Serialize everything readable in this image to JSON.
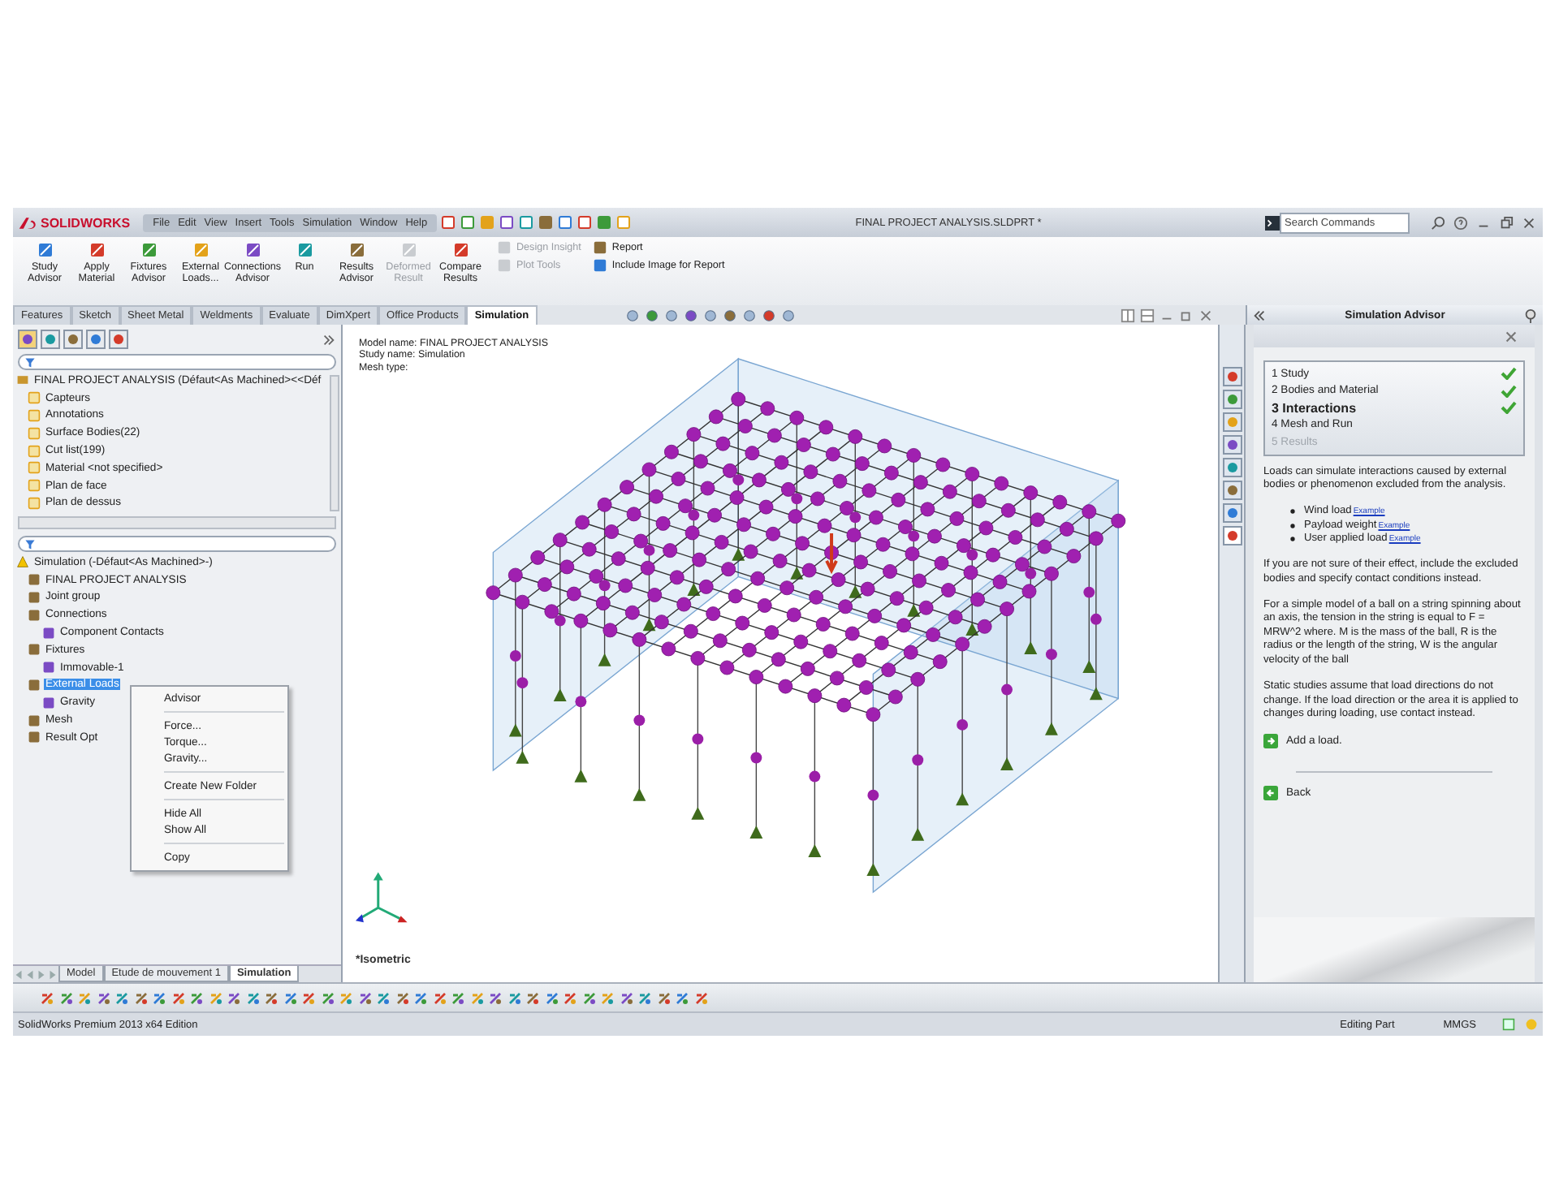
{
  "app": {
    "logo": "SOLIDWORKS",
    "menus": [
      "File",
      "Edit",
      "View",
      "Insert",
      "Tools",
      "Simulation",
      "Window",
      "Help"
    ],
    "document_title": "FINAL PROJECT ANALYSIS.SLDPRT *",
    "search": {
      "placeholder": "Search Commands"
    }
  },
  "command_manager": [
    {
      "label": "Study Advisor",
      "kind": "large",
      "disabled": false
    },
    {
      "label": "Apply Material",
      "kind": "large",
      "disabled": false
    },
    {
      "label": "Fixtures Advisor",
      "kind": "large",
      "disabled": false
    },
    {
      "label": "External Loads...",
      "kind": "large",
      "disabled": false
    },
    {
      "label": "Connections Advisor",
      "kind": "large",
      "disabled": false
    },
    {
      "label": "Run",
      "kind": "large",
      "disabled": false
    },
    {
      "label": "Results Advisor",
      "kind": "large",
      "disabled": false
    },
    {
      "label": "Deformed Result",
      "kind": "large",
      "disabled": true
    },
    {
      "label": "Compare Results",
      "kind": "large",
      "disabled": false
    },
    {
      "label": "Design Insight",
      "kind": "small",
      "disabled": true
    },
    {
      "label": "Plot Tools",
      "kind": "small",
      "disabled": true
    },
    {
      "label": "Report",
      "kind": "small",
      "disabled": false
    },
    {
      "label": "Include Image for Report",
      "kind": "small",
      "disabled": false
    }
  ],
  "tabs": [
    {
      "label": "Features",
      "selected": false
    },
    {
      "label": "Sketch",
      "selected": false
    },
    {
      "label": "Sheet Metal",
      "selected": false
    },
    {
      "label": "Weldments",
      "selected": false
    },
    {
      "label": "Evaluate",
      "selected": false
    },
    {
      "label": "DimXpert",
      "selected": false
    },
    {
      "label": "Office Products",
      "selected": false
    },
    {
      "label": "Simulation",
      "selected": true
    }
  ],
  "feature_tree": {
    "root": "FINAL PROJECT ANALYSIS  (Défaut<As Machined><<Déf",
    "children": [
      {
        "label": "Capteurs"
      },
      {
        "label": "Annotations"
      },
      {
        "label": "Surface Bodies(22)"
      },
      {
        "label": "Cut list(199)"
      },
      {
        "label": "Material <not specified>"
      },
      {
        "label": "Plan de face"
      },
      {
        "label": "Plan de dessus"
      }
    ]
  },
  "simulation_tree": {
    "root": "Simulation (-Défaut<As Machined>-)",
    "children": [
      {
        "label": "FINAL PROJECT ANALYSIS",
        "selected": false
      },
      {
        "label": "Joint group",
        "selected": false
      },
      {
        "label": "Connections",
        "selected": false,
        "children": [
          {
            "label": "Component Contacts",
            "selected": false
          }
        ]
      },
      {
        "label": "Fixtures",
        "selected": false,
        "children": [
          {
            "label": "Immovable-1",
            "selected": false
          }
        ]
      },
      {
        "label": "External Loads",
        "selected": true,
        "children": [
          {
            "label": "Gravity",
            "selected": false
          }
        ]
      },
      {
        "label": "Mesh",
        "selected": false
      },
      {
        "label": "Result Opt",
        "selected": false
      }
    ]
  },
  "context_menu": [
    {
      "kind": "item",
      "label": "Advisor"
    },
    {
      "kind": "separator"
    },
    {
      "kind": "item",
      "label": "Force..."
    },
    {
      "kind": "item",
      "label": "Torque..."
    },
    {
      "kind": "item",
      "label": "Gravity..."
    },
    {
      "kind": "separator"
    },
    {
      "kind": "item",
      "label": "Create New Folder"
    },
    {
      "kind": "separator"
    },
    {
      "kind": "item",
      "label": "Hide All"
    },
    {
      "kind": "item",
      "label": "Show All"
    },
    {
      "kind": "separator"
    },
    {
      "kind": "item",
      "label": "Copy"
    }
  ],
  "canvas": {
    "header": [
      "Model name: FINAL PROJECT ANALYSIS",
      "Study name: Simulation",
      "Mesh type:"
    ],
    "view_label": "*Isometric"
  },
  "bottom_tabs": [
    {
      "label": "Model",
      "selected": false
    },
    {
      "label": "Etude de mouvement 1",
      "selected": false
    },
    {
      "label": "Simulation",
      "selected": true
    }
  ],
  "advisor": {
    "title": "Simulation Advisor",
    "steps": [
      {
        "number": "1",
        "label": "Study",
        "done": true,
        "current": false,
        "disabled": false
      },
      {
        "number": "2",
        "label": "Bodies and Material",
        "done": true,
        "current": false,
        "disabled": false
      },
      {
        "number": "3",
        "label": "Interactions",
        "done": true,
        "current": true,
        "disabled": false
      },
      {
        "number": "4",
        "label": "Mesh and Run",
        "done": false,
        "current": false,
        "disabled": false
      },
      {
        "number": "5",
        "label": "Results",
        "done": false,
        "current": false,
        "disabled": true
      }
    ],
    "intro": "Loads can simulate interactions caused by external bodies or phenomenon excluded from the analysis.",
    "bullets": [
      {
        "text": "Wind load",
        "link": "Example"
      },
      {
        "text": "Payload weight",
        "link": "Example"
      },
      {
        "text": "User applied load",
        "link": "Example"
      }
    ],
    "paragraphs": [
      "If you are not sure of their effect, include the excluded bodies and specify contact conditions instead.",
      "For a simple model of a ball on a string spinning about an axis, the tension in the string is equal to F = MRW^2 where. M is the mass of the ball, R is the radius or the length of the string, W is the angular velocity of the ball",
      "Static studies assume that load directions do not change. If the load direction or the area it is applied to changes during loading, use contact instead."
    ],
    "actions": [
      {
        "kind": "next",
        "label": "Add a load."
      },
      {
        "kind": "back",
        "label": "Back"
      }
    ]
  },
  "status_bar": {
    "product": "SolidWorks Premium 2013 x64 Edition",
    "mode": "Editing Part",
    "units": "MMGS"
  }
}
